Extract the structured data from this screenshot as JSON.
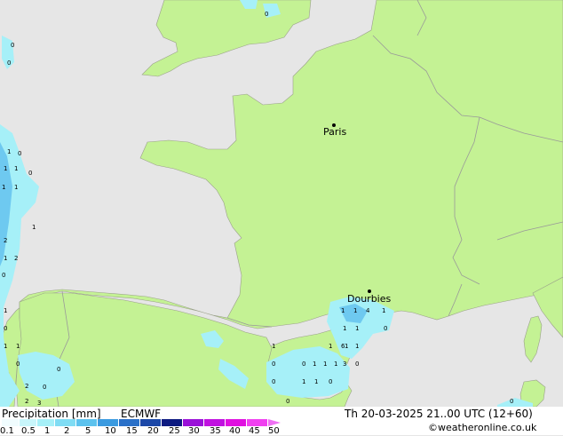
{
  "map": {
    "cities": [
      "Paris",
      "Dourbies"
    ],
    "colors": {
      "land": "#c4f294",
      "sea": "#e6e6e6",
      "border": "#999999",
      "precip_light": "#a6f0f8",
      "precip_medium": "#6ec9f0"
    },
    "precip_values": [
      "0",
      "0",
      "1",
      "0",
      "1",
      "1",
      "0",
      "1",
      "1",
      "1",
      "2",
      "1",
      "2",
      "0",
      "1",
      "0",
      "1",
      "1",
      "0",
      "2",
      "0",
      "0",
      "2",
      "3",
      "1",
      "1",
      "4",
      "1",
      "1",
      "1",
      "1",
      "1",
      "0",
      "1",
      "6",
      "0",
      "1",
      "1",
      "1",
      "3",
      "0",
      "0",
      "1",
      "1",
      "0",
      "0",
      "1",
      "0",
      "0",
      "0"
    ]
  },
  "footer": {
    "title": "Precipitation [mm]",
    "model": "ECMWF",
    "datetime": "Th 20-03-2025 21..00 UTC (12+60)",
    "credit": "©weatheronline.co.uk"
  },
  "legend": {
    "labels": [
      "0.1",
      "0.5",
      "1",
      "2",
      "5",
      "10",
      "15",
      "20",
      "25",
      "30",
      "35",
      "40",
      "45",
      "50"
    ],
    "colors": [
      "#f0fcfe",
      "#c8f6fb",
      "#a6f0f8",
      "#7fdcf4",
      "#5cc2ee",
      "#3a9ae0",
      "#2a70c8",
      "#1c48a8",
      "#0c1a80",
      "#9a10d8",
      "#c010e0",
      "#e010e0",
      "#f040f0",
      "#f070f4"
    ]
  }
}
